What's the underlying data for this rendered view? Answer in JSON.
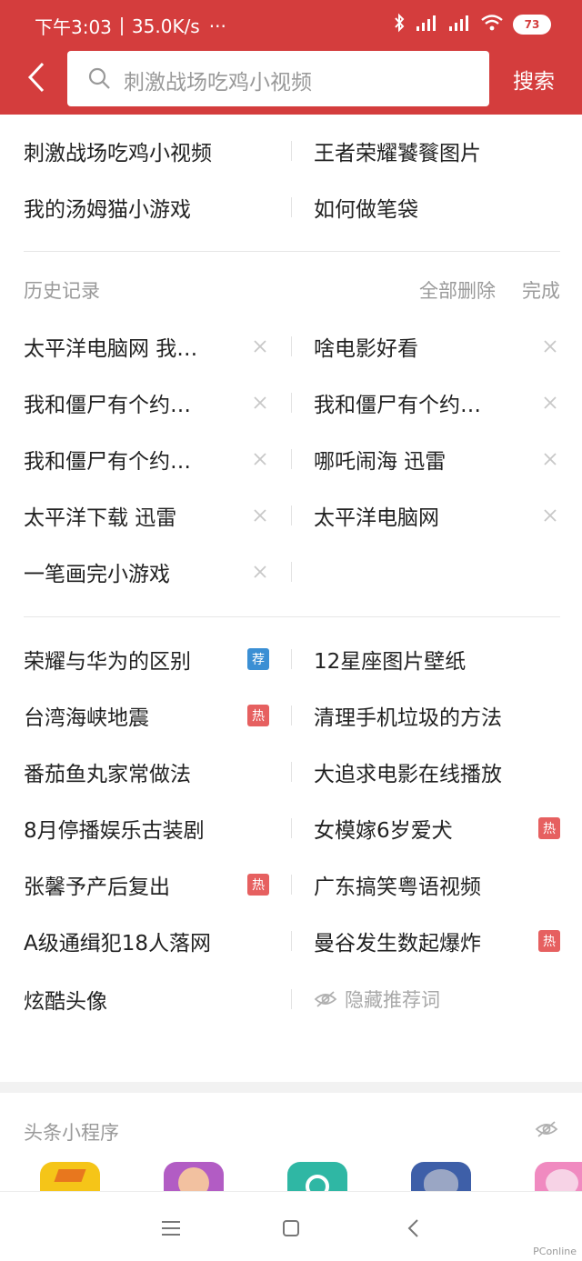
{
  "status_bar": {
    "time": "下午3:03",
    "net_speed": "35.0K/s",
    "dots": "···",
    "battery": "73"
  },
  "search": {
    "query": "刺激战场吃鸡小视频",
    "button_label": "搜索"
  },
  "suggestions": [
    [
      "刺激战场吃鸡小视频",
      "王者荣耀饕餮图片"
    ],
    [
      "我的汤姆猫小游戏",
      "如何做笔袋"
    ]
  ],
  "history": {
    "title": "历史记录",
    "delete_all": "全部删除",
    "done": "完成",
    "rows": [
      [
        "太平洋电脑网 我…",
        "啥电影好看"
      ],
      [
        "我和僵尸有个约…",
        "我和僵尸有个约…"
      ],
      [
        "我和僵尸有个约…",
        "哪吒闹海 迅雷"
      ],
      [
        "太平洋下载 迅雷",
        "太平洋电脑网"
      ],
      [
        "一笔画完小游戏",
        ""
      ]
    ]
  },
  "trending": {
    "rows": [
      [
        {
          "text": "荣耀与华为的区别",
          "badge": "荐",
          "badge_color": "#3b8fd4"
        },
        {
          "text": "12星座图片壁纸",
          "badge": "",
          "badge_color": ""
        }
      ],
      [
        {
          "text": "台湾海峡地震",
          "badge": "热",
          "badge_color": "#e66060"
        },
        {
          "text": "清理手机垃圾的方法",
          "badge": "",
          "badge_color": ""
        }
      ],
      [
        {
          "text": "番茄鱼丸家常做法",
          "badge": "",
          "badge_color": ""
        },
        {
          "text": "大追求电影在线播放",
          "badge": "",
          "badge_color": ""
        }
      ],
      [
        {
          "text": "8月停播娱乐古装剧",
          "badge": "",
          "badge_color": ""
        },
        {
          "text": "女模嫁6岁爱犬",
          "badge": "热",
          "badge_color": "#e66060"
        }
      ],
      [
        {
          "text": "张馨予产后复出",
          "badge": "热",
          "badge_color": "#e66060"
        },
        {
          "text": "广东搞笑粤语视频",
          "badge": "",
          "badge_color": ""
        }
      ],
      [
        {
          "text": "A级通缉犯18人落网",
          "badge": "",
          "badge_color": ""
        },
        {
          "text": "曼谷发生数起爆炸",
          "badge": "热",
          "badge_color": "#e66060"
        }
      ]
    ],
    "last_left": "炫酷头像",
    "hide_label": "隐藏推荐词"
  },
  "mini_programs": {
    "title": "头条小程序",
    "app_colors": [
      "#f5c518",
      "#b25cc4",
      "#2fb7a4",
      "#3e5fa8",
      "#f08ac0"
    ]
  },
  "watermark": "PConline",
  "colors": {
    "brand_red": "#d43d3d",
    "hot_badge": "#e66060",
    "recommend_badge": "#3b8fd4"
  }
}
